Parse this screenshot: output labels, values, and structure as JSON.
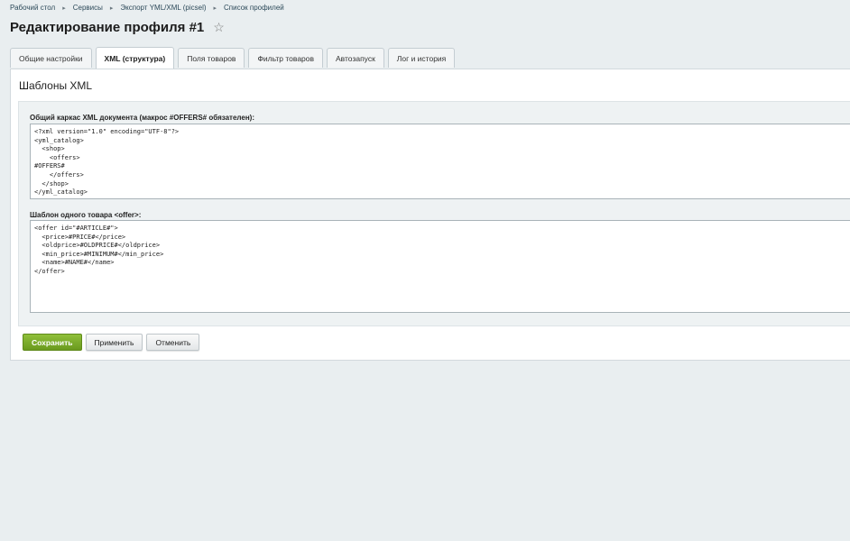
{
  "breadcrumb": {
    "items": [
      "Рабочий стол",
      "Сервисы",
      "Экспорт YML/XML (picsel)",
      "Список профилей"
    ],
    "separator": "▸"
  },
  "page": {
    "title": "Редактирование профиля #1",
    "favorite_icon": "star-outline-icon"
  },
  "tabs": [
    {
      "label": "Общие настройки",
      "active": false
    },
    {
      "label": "XML (структура)",
      "active": true
    },
    {
      "label": "Поля товаров",
      "active": false
    },
    {
      "label": "Фильтр товаров",
      "active": false
    },
    {
      "label": "Автозапуск",
      "active": false
    },
    {
      "label": "Лог и история",
      "active": false
    }
  ],
  "section": {
    "title": "Шаблоны XML"
  },
  "fields": {
    "document_template": {
      "label": "Общий каркас XML документа (макрос #OFFERS# обязателен):",
      "value": "<?xml version=\"1.0\" encoding=\"UTF-8\"?>\n<yml_catalog>\n  <shop>\n    <offers>\n#OFFERS#\n    </offers>\n  </shop>\n</yml_catalog>"
    },
    "offer_template": {
      "label": "Шаблон одного товара <offer>:",
      "value": "<offer id=\"#ARTICLE#\">\n  <price>#PRICE#</price>\n  <oldprice>#OLDPRICE#</oldprice>\n  <min_price>#MINIMUM#</min_price>\n  <name>#NAME#</name>\n</offer>"
    }
  },
  "buttons": {
    "save": "Сохранить",
    "apply": "Применить",
    "cancel": "Отменить"
  },
  "colors": {
    "page_bg": "#e9eef0",
    "save_button": "#7aab28"
  }
}
